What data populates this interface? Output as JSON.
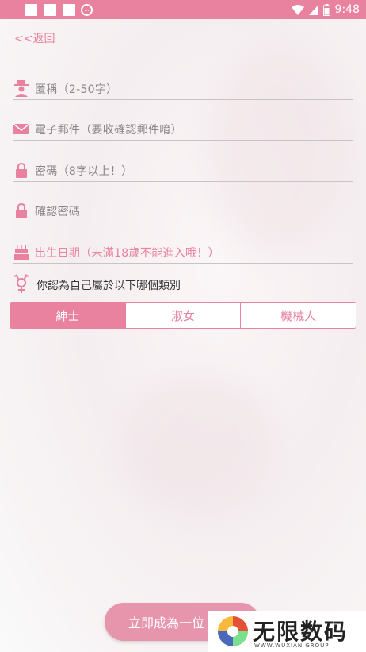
{
  "status_bar": {
    "time": "9:48",
    "notification_badge": "..."
  },
  "back_label": "<<返回",
  "fields": {
    "nickname": "匿稱（2-50字）",
    "email": "電子郵件（要收確認郵件唷）",
    "password": "密碼（8字以上！）",
    "confirm_password": "確認密碼",
    "birthday": "出生日期（未滿18歲不能進入哦！）"
  },
  "gender": {
    "question": "你認為自己屬於以下哪個類別",
    "options": [
      "紳士",
      "淑女",
      "機械人"
    ],
    "selected": "紳士"
  },
  "submit_label": "立即成為一位",
  "watermark": {
    "title": "无限数码",
    "subtitle": "WWW.WUXIAN GROUP"
  },
  "colors": {
    "accent": "#e8829f"
  }
}
